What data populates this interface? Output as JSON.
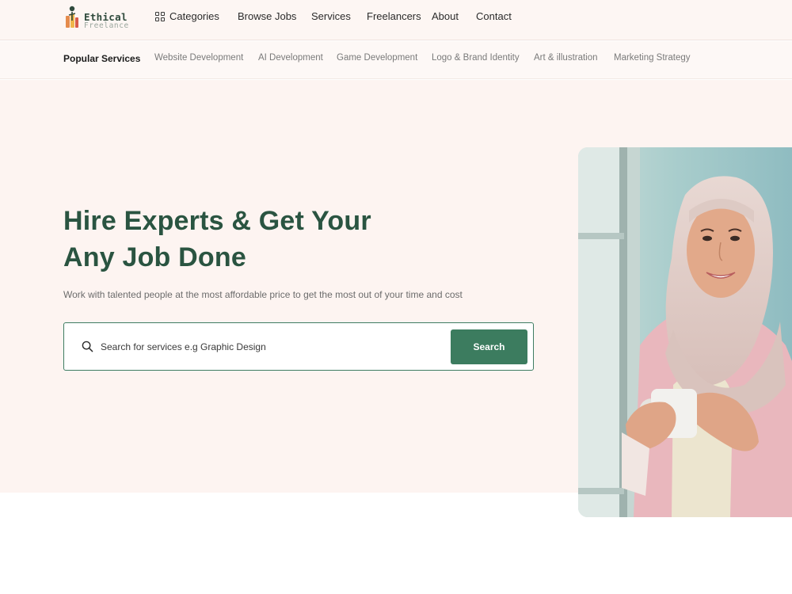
{
  "brand": {
    "name": "Ethical",
    "tagline": "Freelance"
  },
  "nav": {
    "categories": "Categories",
    "browse_jobs": "Browse Jobs",
    "services": "Services",
    "freelancers": "Freelancers",
    "about": "About",
    "contact": "Contact"
  },
  "popular": {
    "heading": "Popular Services",
    "items": [
      "Website Development",
      "AI Development",
      "Game Development",
      "Logo & Brand Identity",
      "Art & illustration",
      "Marketing Strategy"
    ]
  },
  "hero": {
    "title_line1": "Hire Experts & Get Your",
    "title_line2": "Any Job Done",
    "subtitle": "Work with talented people at the most affordable price to get the most out of your time and cost"
  },
  "search": {
    "placeholder": "Search for services e.g Graphic Design",
    "button": "Search"
  },
  "colors": {
    "brand_green": "#3c7c5f",
    "heading_green": "#2a5441",
    "hero_bg": "#fdf4f1"
  },
  "icons": {
    "categories": "grid-icon",
    "search": "search-icon"
  }
}
